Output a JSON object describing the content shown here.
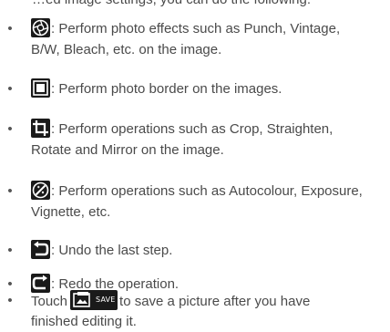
{
  "cutoff_text": "…ed image settings, you can do the following:",
  "items": [
    {
      "icon": "photo-effects-icon",
      "line1": ": Perform photo effects such as Punch, Vintage,",
      "line2": "B/W, Bleach, etc. on the image."
    },
    {
      "icon": "photo-border-icon",
      "line1": ": Perform photo border on the images."
    },
    {
      "icon": "crop-rotate-icon",
      "line1": ": Perform operations such as Crop, Straighten,",
      "line2": "Rotate and Mirror on the image."
    },
    {
      "icon": "adjust-icon",
      "line1": ": Perform operations such as Autocolour, Exposure,",
      "line2": "Vignette, etc."
    },
    {
      "icon": "undo-icon",
      "line1": ": Undo the last step."
    },
    {
      "icon": "redo-icon",
      "line1": ": Redo the operation."
    },
    {
      "prefix": "Touch",
      "button_label": "SAVE",
      "icon": "save-picture-icon",
      "line1": "to save a picture after you have",
      "line2": "finished editing it."
    }
  ],
  "bullet": "•"
}
